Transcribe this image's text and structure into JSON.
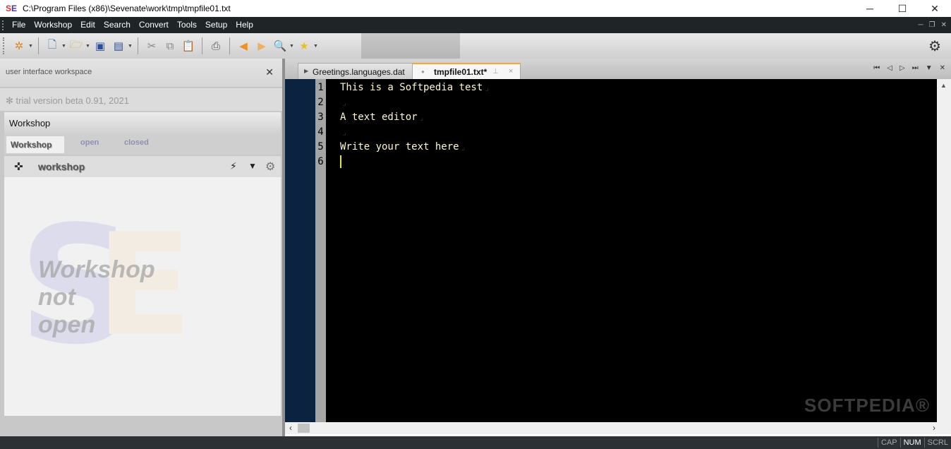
{
  "window": {
    "app_icon": "SE",
    "title": "C:\\Program Files (x86)\\Sevenate\\work\\tmp\\tmpfile01.txt",
    "minimize": "─",
    "maximize": "☐",
    "close": "✕"
  },
  "menu": [
    "File",
    "Workshop",
    "Edit",
    "Search",
    "Convert",
    "Tools",
    "Setup",
    "Help"
  ],
  "toolbar_icons": [
    "tools-icon",
    "new-file-icon",
    "open-folder-icon",
    "save-icon",
    "save-all-icon",
    "cut-icon",
    "copy-icon",
    "paste-icon",
    "print-icon",
    "back-icon",
    "forward-icon",
    "search-icon",
    "favorites-icon",
    "settings-icon"
  ],
  "left_panel": {
    "header": "user interface workspace",
    "close": "✕",
    "trial": "✻ trial version beta 0.91, 2021",
    "workshop_title": "Workshop",
    "tabs": [
      "Workshop",
      "open",
      "closed"
    ],
    "row_label": "workshop",
    "watermark_lines": [
      "Workshop",
      "not",
      "open"
    ],
    "watermark_logo": "SE"
  },
  "editor": {
    "tabs": [
      {
        "label": "Greetings.languages.dat",
        "active": false
      },
      {
        "label": "tmpfile01.txt*",
        "active": true
      }
    ],
    "tab_close": "×",
    "line_numbers": [
      "1",
      "2",
      "3",
      "4",
      "5",
      "6"
    ],
    "lines": [
      "This is a Softpedia test",
      "",
      "A text editor",
      "",
      "Write your text here",
      ""
    ],
    "eol_mark": "⌟",
    "watermark": "SOFTPEDIA®"
  },
  "status": [
    "CAP",
    "NUM",
    "SCRL"
  ],
  "colors": {
    "menu_bg": "#1f2426",
    "editor_bg": "#000000",
    "editor_text": "#fff7d0",
    "tab_accent": "#f0a830"
  }
}
